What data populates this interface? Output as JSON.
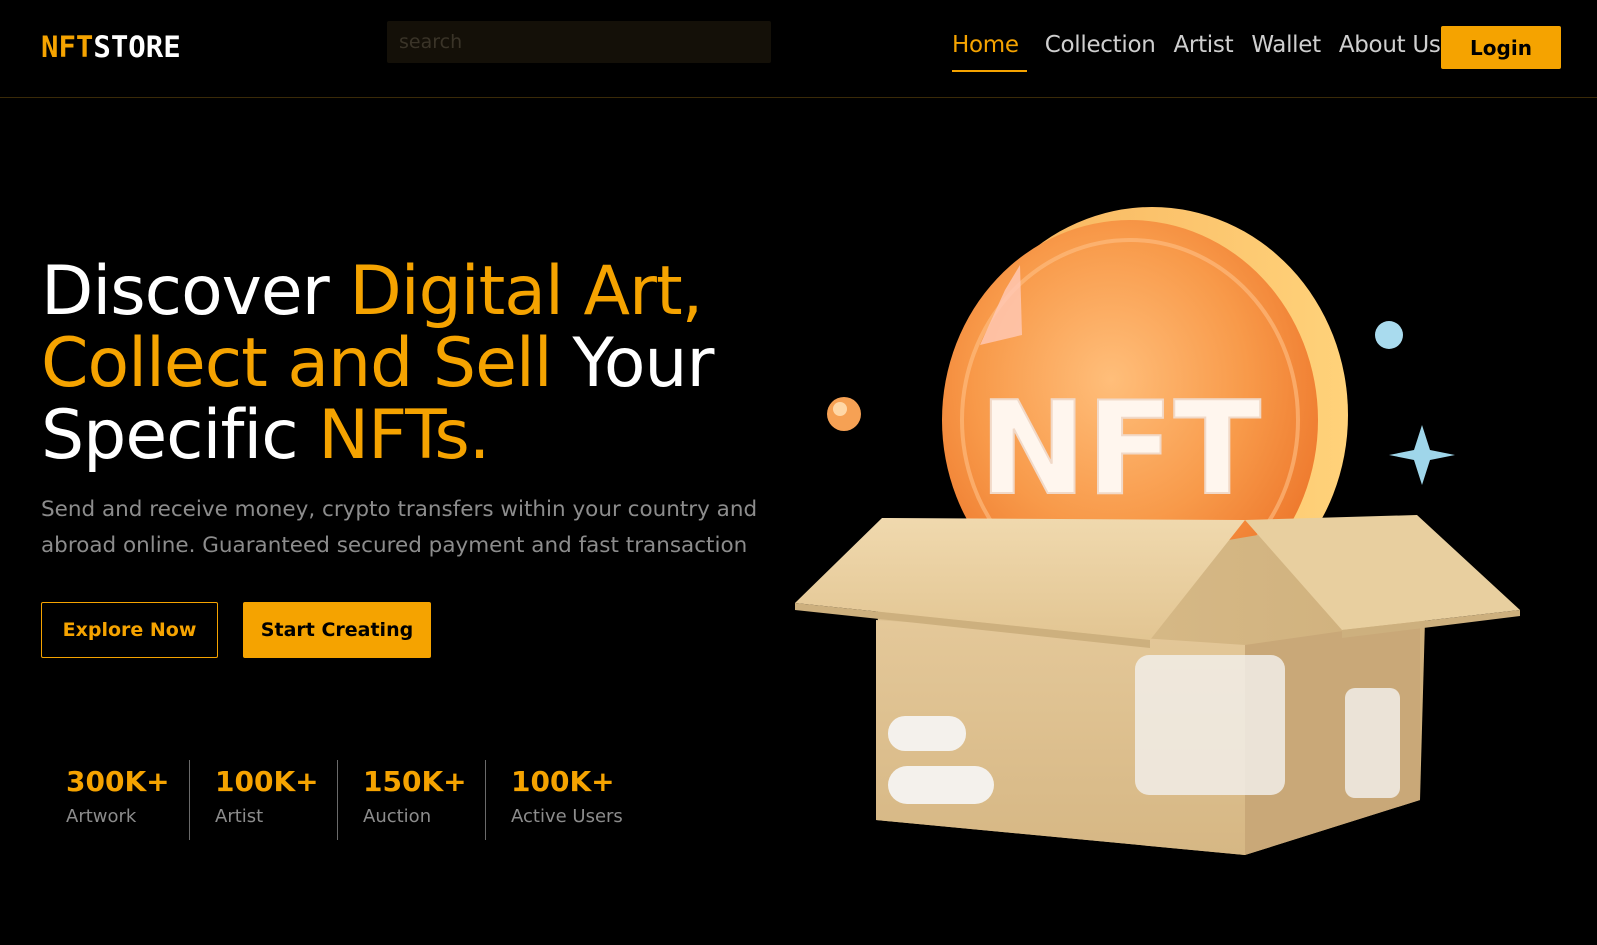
{
  "brand": {
    "logo_accent": "NFT",
    "logo_rest": "STORE"
  },
  "search": {
    "placeholder": "search"
  },
  "nav": {
    "links": [
      {
        "label": "Home",
        "active": true
      },
      {
        "label": "Collection"
      },
      {
        "label": "Artist"
      },
      {
        "label": "Wallet"
      },
      {
        "label": "About Us"
      }
    ],
    "login_label": "Login"
  },
  "hero": {
    "title_parts": {
      "p1": "Discover ",
      "p2": "Digital Art,",
      "p3": "Collect and Sell",
      "p4": " Your",
      "p5": "Specific ",
      "p6": "NFTs."
    },
    "description": "Send and receive money, crypto transfers within your country and abroad online. Guaranteed secured payment and fast transaction",
    "explore_label": "Explore Now",
    "create_label": "Start Creating",
    "illustration_text": "NFT"
  },
  "stats": [
    {
      "value": "300K+",
      "label": "Artwork"
    },
    {
      "value": "100K+",
      "label": "Artist"
    },
    {
      "value": "150K+",
      "label": "Auction"
    },
    {
      "value": "100K+",
      "label": "Active Users"
    }
  ],
  "colors": {
    "accent": "#f5a300",
    "background": "#000000",
    "muted_text": "#8c8c8c"
  },
  "icons": [
    "nft-coin-icon",
    "box-icon",
    "sparkle-icon"
  ]
}
